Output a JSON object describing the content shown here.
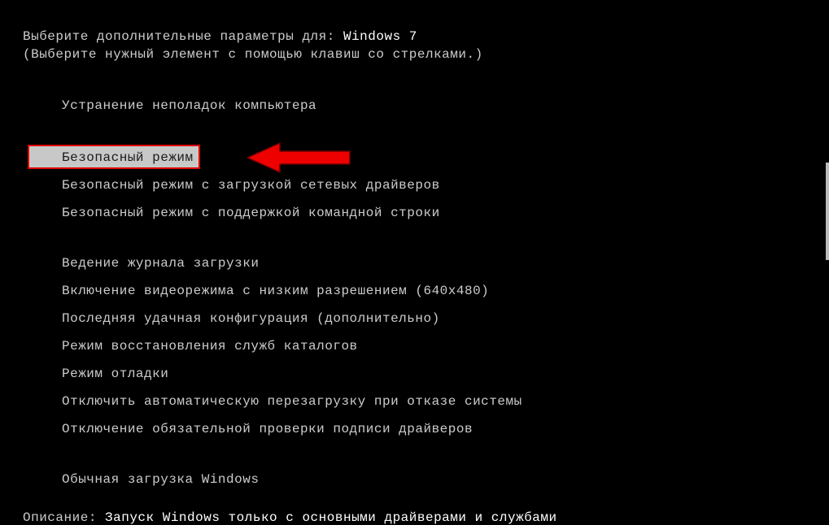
{
  "header": {
    "prompt_prefix": "Выберите дополнительные параметры для: ",
    "os_name": "Windows 7",
    "instruction": "(Выберите нужный элемент с помощью клавиш со стрелками.)"
  },
  "menu": {
    "repair": "Устранение неполадок компьютера",
    "safe_mode": "Безопасный режим",
    "safe_mode_net": "Безопасный режим с загрузкой сетевых драйверов",
    "safe_mode_cmd": "Безопасный режим с поддержкой командной строки",
    "boot_log": "Ведение журнала загрузки",
    "low_res": "Включение видеорежима с низким разрешением (640x480)",
    "last_known": "Последняя удачная конфигурация (дополнительно)",
    "ds_restore": "Режим восстановления служб каталогов",
    "debug": "Режим отладки",
    "disable_auto_restart": "Отключить автоматическую перезагрузку при отказе системы",
    "disable_sig": "Отключение обязательной проверки подписи драйверов",
    "normal": "Обычная загрузка Windows"
  },
  "description": {
    "label": "Описание: ",
    "value": "Запуск Windows только с основными драйверами и службами"
  },
  "colors": {
    "bg": "#000000",
    "text": "#cccccc",
    "highlight_text": "#ffffff",
    "selected_bg": "#c8c8c8",
    "selected_border": "#dd0000",
    "arrow_fill": "#ee0000"
  }
}
